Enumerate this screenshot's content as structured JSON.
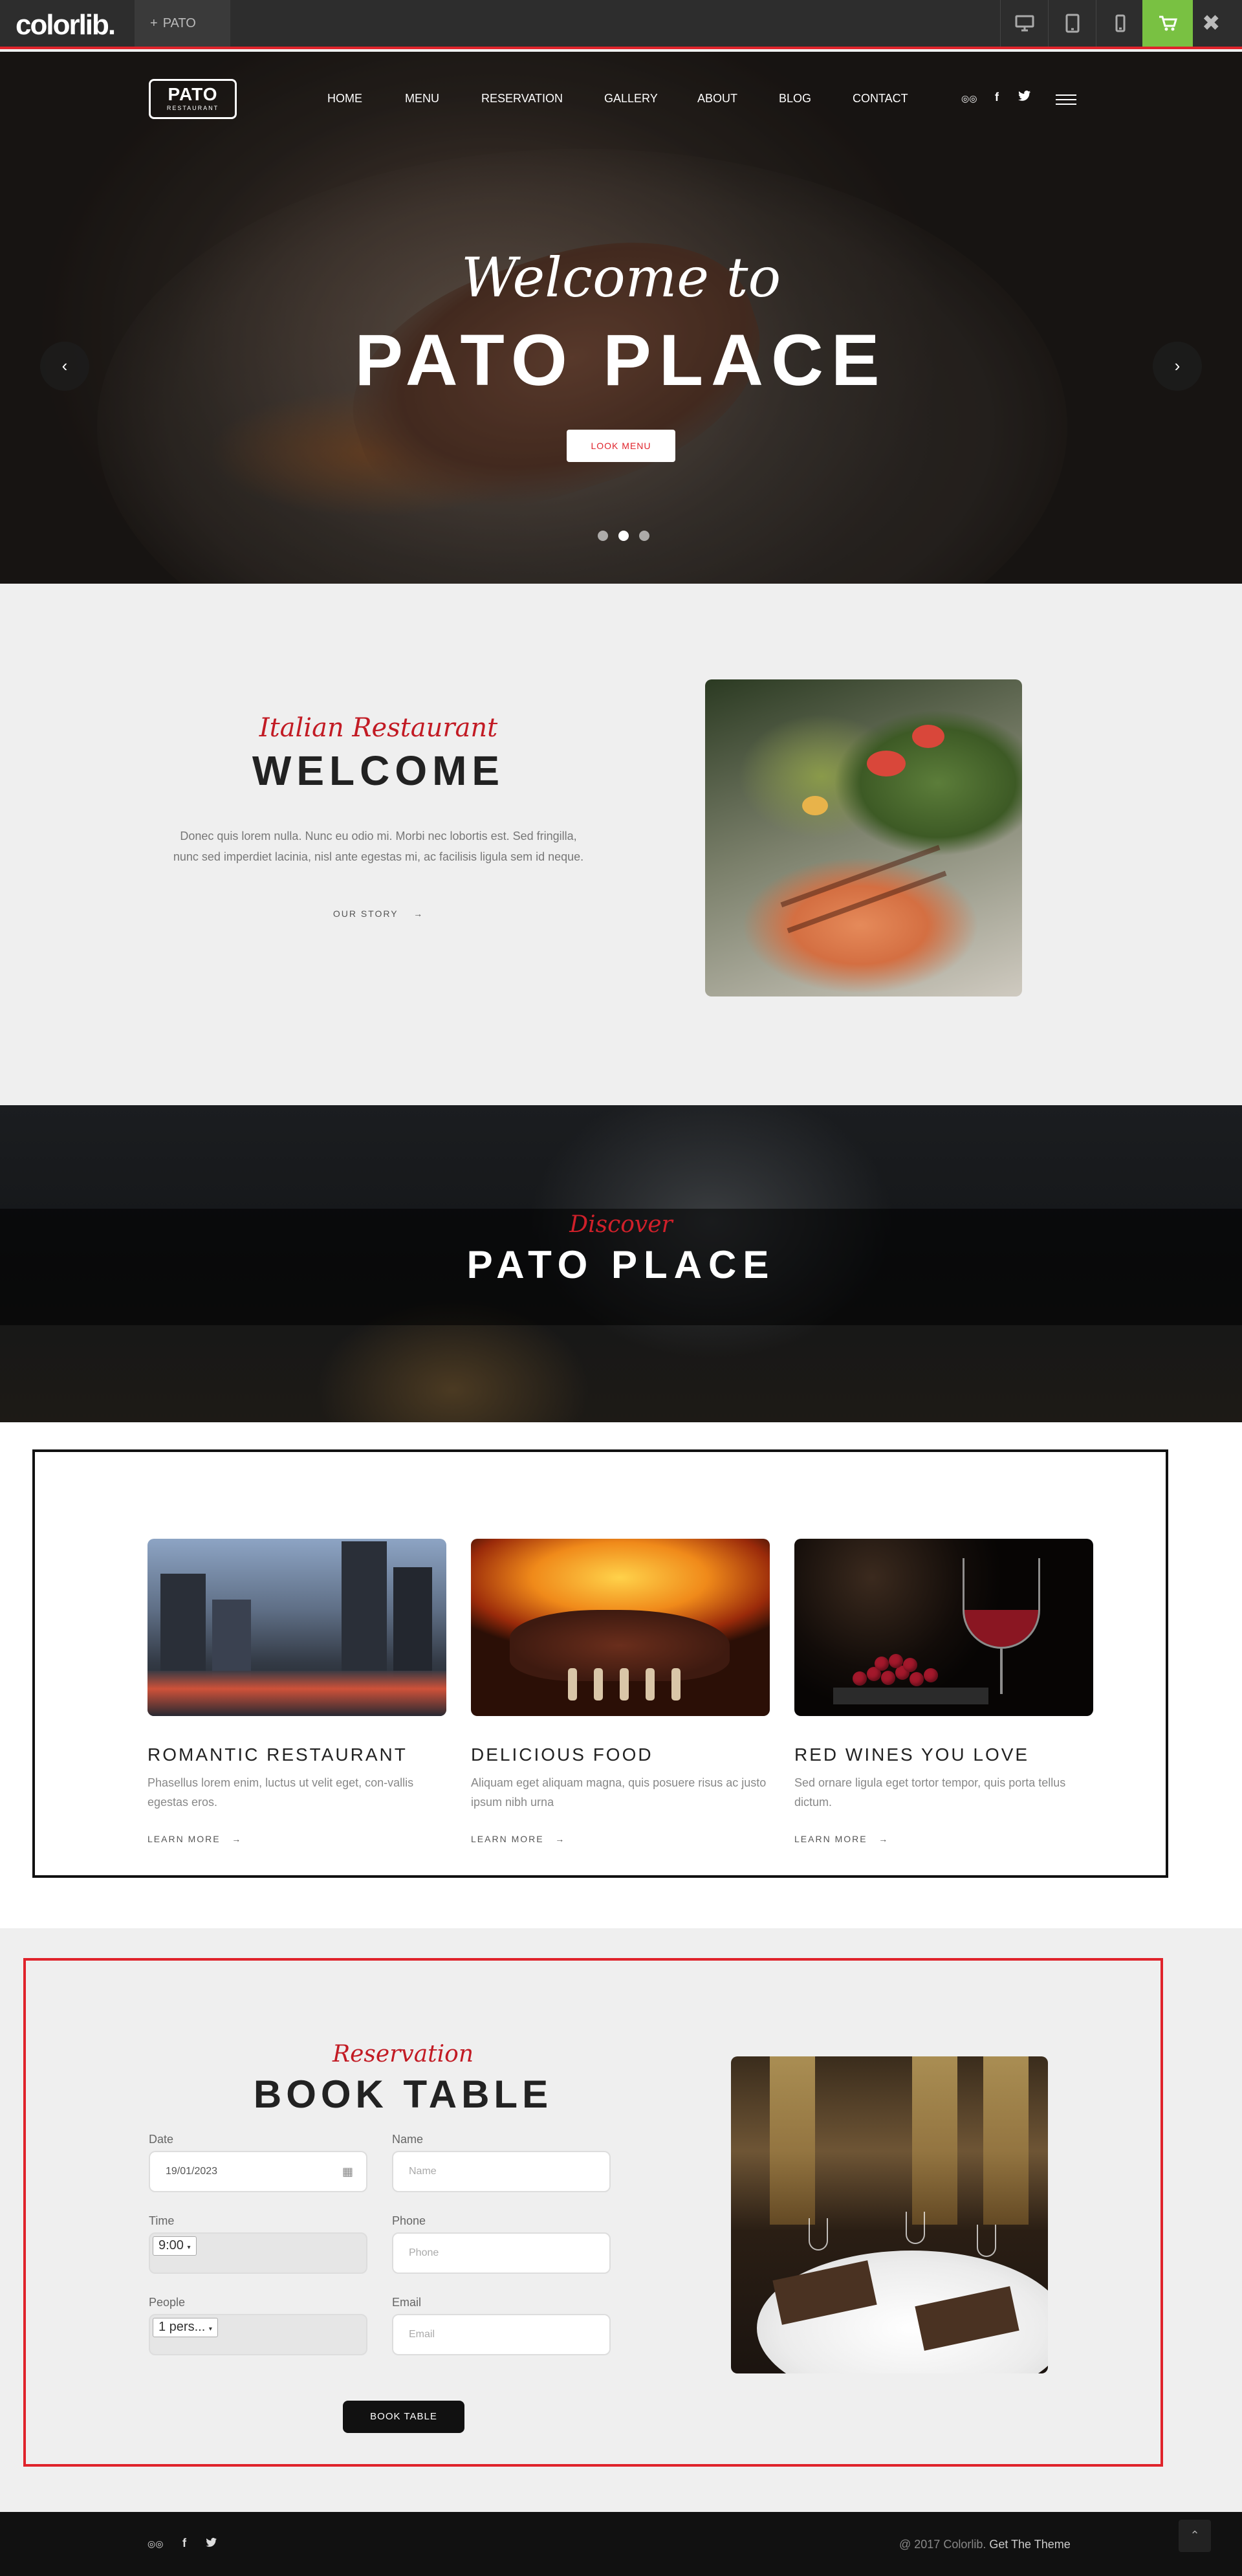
{
  "colorlib_bar": {
    "logo": "colorlib.",
    "tab_label": "PATO",
    "tab_icon": "+",
    "devices": [
      "desktop-icon",
      "tablet-icon",
      "mobile-icon"
    ],
    "cart_icon": "cart-icon",
    "close_symbol": "✖",
    "accent": "#e0232b",
    "cart_color": "#79c142"
  },
  "nav": {
    "logo_main": "PATO",
    "logo_sub": "RESTAURANT",
    "items": [
      "HOME",
      "MENU",
      "RESERVATION",
      "GALLERY",
      "ABOUT",
      "BLOG",
      "CONTACT"
    ],
    "social": [
      "tripadvisor-icon",
      "facebook-icon",
      "twitter-icon"
    ],
    "social_glyphs": [
      "◎◎",
      "f",
      "t"
    ]
  },
  "hero": {
    "subtitle": "Welcome to",
    "title": "PATO PLACE",
    "button": "LOOK MENU",
    "prev": "‹",
    "next": "›",
    "slide_count": 3,
    "active_slide": 2
  },
  "welcome": {
    "subtitle": "Italian Restaurant",
    "title": "WELCOME",
    "text": "Donec quis lorem nulla. Nunc eu odio mi. Morbi nec lobortis est. Sed fringilla, nunc sed imperdiet lacinia, nisl ante egestas mi, ac facilisis ligula sem id neque.",
    "link": "OUR STORY",
    "arrow": "→"
  },
  "discover": {
    "subtitle": "Discover",
    "title": "PATO PLACE"
  },
  "features": [
    {
      "title": "ROMANTIC RESTAURANT",
      "text": "Phasellus lorem enim, luctus ut velit eget, con-vallis egestas eros.",
      "link": "LEARN MORE"
    },
    {
      "title": "DELICIOUS FOOD",
      "text": "Aliquam eget aliquam magna, quis posuere risus ac justo ipsum nibh urna",
      "link": "LEARN MORE"
    },
    {
      "title": "RED WINES YOU LOVE",
      "text": "Sed ornare ligula eget tortor tempor, quis porta tellus dictum.",
      "link": "LEARN MORE"
    }
  ],
  "reservation": {
    "subtitle": "Reservation",
    "title": "BOOK TABLE",
    "date_label": "Date",
    "date_value": "19/01/2023",
    "time_label": "Time",
    "time_value": "9:00",
    "people_label": "People",
    "people_value": "1 pers...",
    "name_label": "Name",
    "name_placeholder": "Name",
    "phone_label": "Phone",
    "phone_placeholder": "Phone",
    "email_label": "Email",
    "email_placeholder": "Email",
    "button": "BOOK TABLE",
    "border_color": "#e0232b"
  },
  "footer": {
    "social_glyphs": [
      "◎◎",
      "f",
      "t"
    ],
    "copyright": "@ 2017 Colorlib.",
    "theme_link": "Get The Theme",
    "back_to_top": "⌃"
  }
}
